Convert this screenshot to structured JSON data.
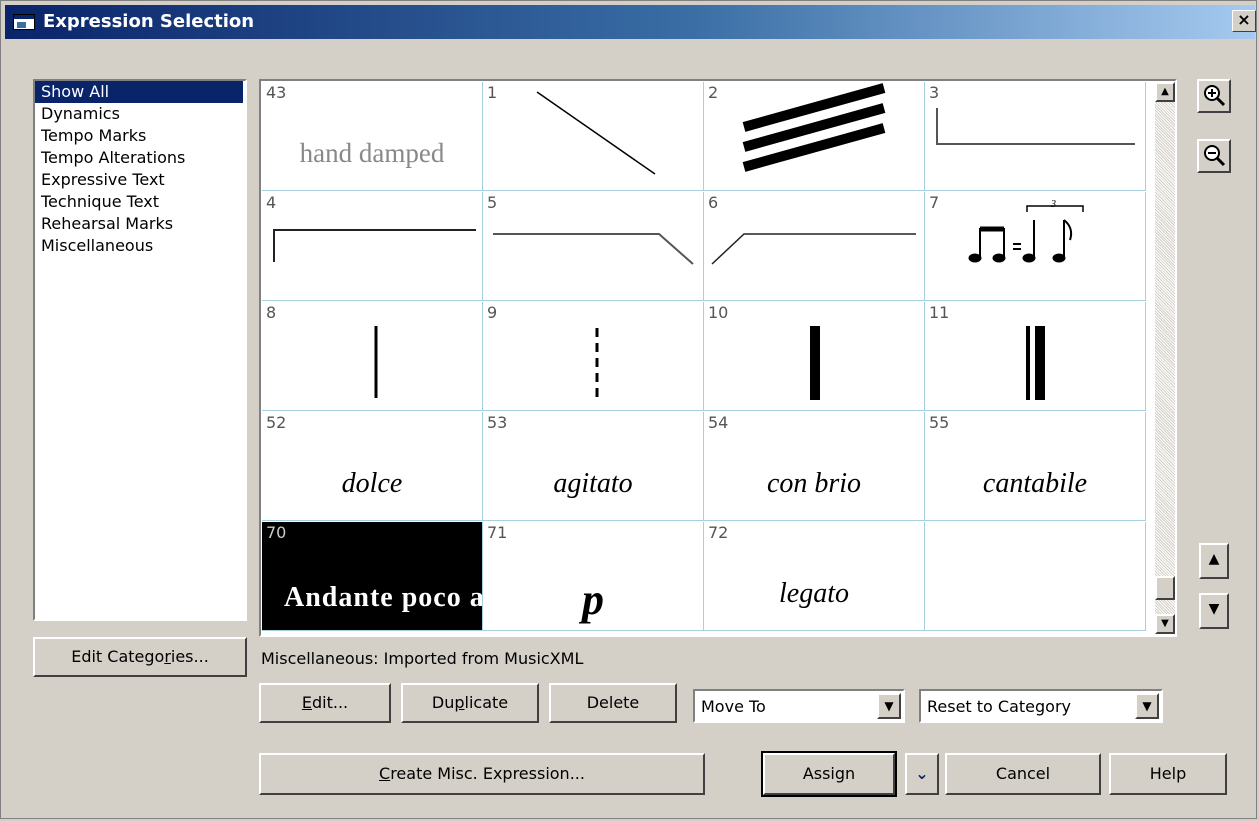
{
  "window": {
    "title": "Expression Selection",
    "close_label": "×"
  },
  "categories": [
    "Show All",
    "Dynamics",
    "Tempo Marks",
    "Tempo Alterations",
    "Expressive Text",
    "Technique Text",
    "Rehearsal Marks",
    "Miscellaneous"
  ],
  "selected_category": "Show All",
  "edit_categories_button": {
    "pre": "Edit Catego",
    "key": "r",
    "post": "ies..."
  },
  "grid": {
    "cells": [
      {
        "num": "43",
        "text": "hand damped",
        "kind": "text-gray"
      },
      {
        "num": "1",
        "kind": "diag-line"
      },
      {
        "num": "2",
        "kind": "thick-lines"
      },
      {
        "num": "3",
        "kind": "bracket-bottom"
      },
      {
        "num": "4",
        "kind": "bracket-left"
      },
      {
        "num": "5",
        "kind": "line-drop"
      },
      {
        "num": "6",
        "kind": "line-rise"
      },
      {
        "num": "7",
        "kind": "swing-notation"
      },
      {
        "num": "8",
        "kind": "thin-barline"
      },
      {
        "num": "9",
        "kind": "dashed-barline"
      },
      {
        "num": "10",
        "kind": "thick-barline"
      },
      {
        "num": "11",
        "kind": "double-barline"
      },
      {
        "num": "52",
        "text": "dolce",
        "kind": "italic"
      },
      {
        "num": "53",
        "text": "agitato",
        "kind": "italic"
      },
      {
        "num": "54",
        "text": "con brio",
        "kind": "italic"
      },
      {
        "num": "55",
        "text": "cantabile",
        "kind": "italic"
      },
      {
        "num": "70",
        "text": "Andante poco a",
        "kind": "bold-selected"
      },
      {
        "num": "71",
        "text": "p",
        "kind": "dynamic"
      },
      {
        "num": "72",
        "text": "legato",
        "kind": "italic"
      },
      {
        "num": "",
        "kind": "empty"
      }
    ]
  },
  "status_text": "Miscellaneous: Imported from MusicXML",
  "buttons": {
    "edit": {
      "key": "E",
      "post": "dit..."
    },
    "duplicate": {
      "pre": "Du",
      "key": "p",
      "post": "licate"
    },
    "delete": "Delete",
    "create": {
      "key": "C",
      "post": "reate Misc. Expression..."
    },
    "assign": "Assign",
    "cancel": "Cancel",
    "help": "Help"
  },
  "move_to": {
    "value": "Move To"
  },
  "reset_to": {
    "value": "Reset to Category"
  },
  "icons": {
    "zoom_in": "zoom-in-icon",
    "zoom_out": "zoom-out-icon",
    "up": "arrow-up-icon",
    "down": "arrow-down-icon"
  }
}
